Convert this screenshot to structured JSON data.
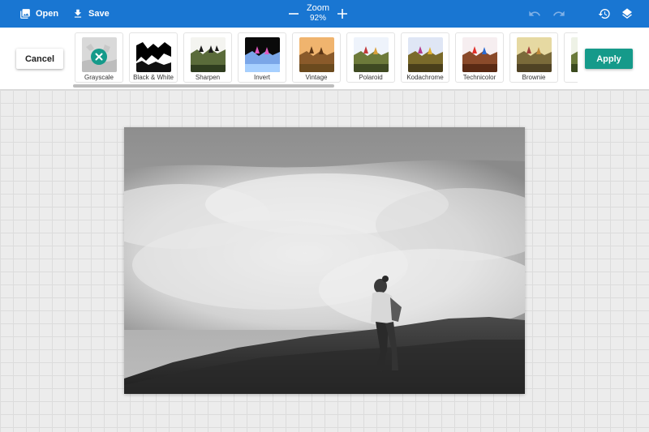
{
  "toolbar": {
    "open_label": "Open",
    "save_label": "Save",
    "zoom_label": "Zoom",
    "zoom_value": "92%",
    "icons": [
      "image-icon",
      "download-icon",
      "minus-icon",
      "plus-icon",
      "undo-icon",
      "redo-icon",
      "history-icon",
      "layers-icon"
    ]
  },
  "actions": {
    "cancel_label": "Cancel",
    "apply_label": "Apply"
  },
  "filters": [
    {
      "label": "Grayscale",
      "selected": true
    },
    {
      "label": "Black & White"
    },
    {
      "label": "Sharpen"
    },
    {
      "label": "Invert"
    },
    {
      "label": "Vintage"
    },
    {
      "label": "Polaroid"
    },
    {
      "label": "Kodachrome"
    },
    {
      "label": "Technicolor"
    },
    {
      "label": "Brownie"
    }
  ],
  "colors": {
    "topbar": "#1976d2",
    "accent": "#159a8a"
  }
}
